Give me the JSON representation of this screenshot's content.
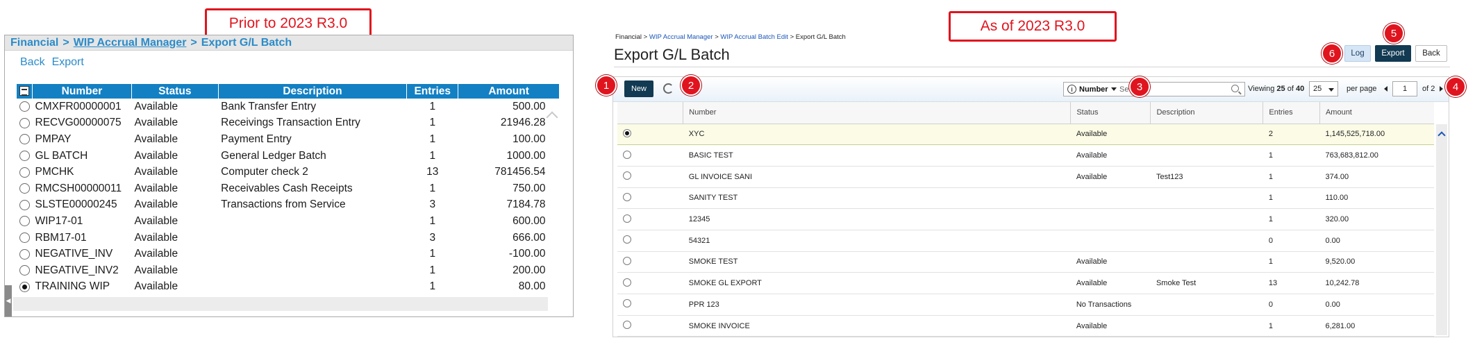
{
  "labels": {
    "prior": "Prior to 2023 R3.0",
    "asof": "As of 2023 R3.0"
  },
  "old": {
    "breadcrumb": {
      "financial": "Financial",
      "sep1": ">",
      "wip": "WIP Accrual Manager",
      "sep2": ">",
      "current": "Export G/L Batch"
    },
    "actions": {
      "back": "Back",
      "export": "Export"
    },
    "columns": [
      "Number",
      "Status",
      "Description",
      "Entries",
      "Amount"
    ],
    "rows": [
      {
        "number": "CMXFR00000001",
        "status": "Available",
        "description": "Bank Transfer Entry",
        "entries": "1",
        "amount": "500.00"
      },
      {
        "number": "RECVG00000075",
        "status": "Available",
        "description": "Receivings Transaction Entry",
        "entries": "1",
        "amount": "21946.28"
      },
      {
        "number": "PMPAY",
        "status": "Available",
        "description": "Payment Entry",
        "entries": "1",
        "amount": "100.00"
      },
      {
        "number": "GL BATCH",
        "status": "Available",
        "description": "General Ledger Batch",
        "entries": "1",
        "amount": "1000.00"
      },
      {
        "number": "PMCHK",
        "status": "Available",
        "description": "Computer check 2",
        "entries": "13",
        "amount": "781456.54"
      },
      {
        "number": "RMCSH00000011",
        "status": "Available",
        "description": "Receivables Cash Receipts",
        "entries": "1",
        "amount": "750.00"
      },
      {
        "number": "SLSTE00000245",
        "status": "Available",
        "description": "Transactions from Service",
        "entries": "3",
        "amount": "7184.78"
      },
      {
        "number": "WIP17-01",
        "status": "Available",
        "description": "",
        "entries": "1",
        "amount": "600.00"
      },
      {
        "number": "RBM17-01",
        "status": "Available",
        "description": "",
        "entries": "3",
        "amount": "666.00"
      },
      {
        "number": "NEGATIVE_INV",
        "status": "Available",
        "description": "",
        "entries": "1",
        "amount": "-100.00"
      },
      {
        "number": "NEGATIVE_INV2",
        "status": "Available",
        "description": "",
        "entries": "1",
        "amount": "200.00"
      },
      {
        "number": "TRAINING WIP",
        "status": "Available",
        "description": "",
        "entries": "1",
        "amount": "80.00",
        "selected": true
      }
    ]
  },
  "new": {
    "breadcrumb": {
      "financial": "Financial",
      "sep1": ">",
      "wip": "WIP Accrual Manager",
      "sep2": ">",
      "edit": "WIP Accrual Batch Edit",
      "sep3": ">",
      "current": "Export G/L Batch"
    },
    "title": "Export G/L Batch",
    "buttons": {
      "log": "Log",
      "export": "Export",
      "back": "Back",
      "new": "New"
    },
    "search": {
      "mode": "Number",
      "value": "Se     rr"
    },
    "paging": {
      "viewing_prefix": "Viewing",
      "viewing_count": "25",
      "viewing_of": "of",
      "viewing_total": "40",
      "per_page_value": "25",
      "per_page_label": "per page",
      "page": "1",
      "of_label": "of 2"
    },
    "columns": [
      "Number",
      "Status",
      "Description",
      "Entries",
      "Amount"
    ],
    "rows": [
      {
        "number": "XYC",
        "status": "Available",
        "description": "",
        "entries": "2",
        "amount": "1,145,525,718.00",
        "selected": true
      },
      {
        "number": "BASIC TEST",
        "status": "Available",
        "description": "",
        "entries": "1",
        "amount": "763,683,812.00"
      },
      {
        "number": "GL INVOICE SANI",
        "status": "Available",
        "description": "Test123",
        "entries": "1",
        "amount": "374.00"
      },
      {
        "number": "SANITY TEST",
        "status": "",
        "description": "",
        "entries": "1",
        "amount": "110.00"
      },
      {
        "number": "12345",
        "status": "",
        "description": "",
        "entries": "1",
        "amount": "320.00"
      },
      {
        "number": "54321",
        "status": "",
        "description": "",
        "entries": "0",
        "amount": "0.00"
      },
      {
        "number": "SMOKE TEST",
        "status": "Available",
        "description": "",
        "entries": "1",
        "amount": "9,520.00"
      },
      {
        "number": "SMOKE GL EXPORT",
        "status": "Available",
        "description": "Smoke Test",
        "entries": "13",
        "amount": "10,242.78"
      },
      {
        "number": "PPR 123",
        "status": "No Transactions",
        "description": "",
        "entries": "0",
        "amount": "0.00"
      },
      {
        "number": "SMOKE INVOICE",
        "status": "Available",
        "description": "",
        "entries": "1",
        "amount": "6,281.00"
      }
    ]
  },
  "markers": [
    "1",
    "2",
    "3",
    "4",
    "5",
    "6"
  ],
  "colors": {
    "callout": "#e0141e",
    "old_header": "#1380c3",
    "new_primary": "#123a52",
    "link": "#2a8bc9"
  }
}
